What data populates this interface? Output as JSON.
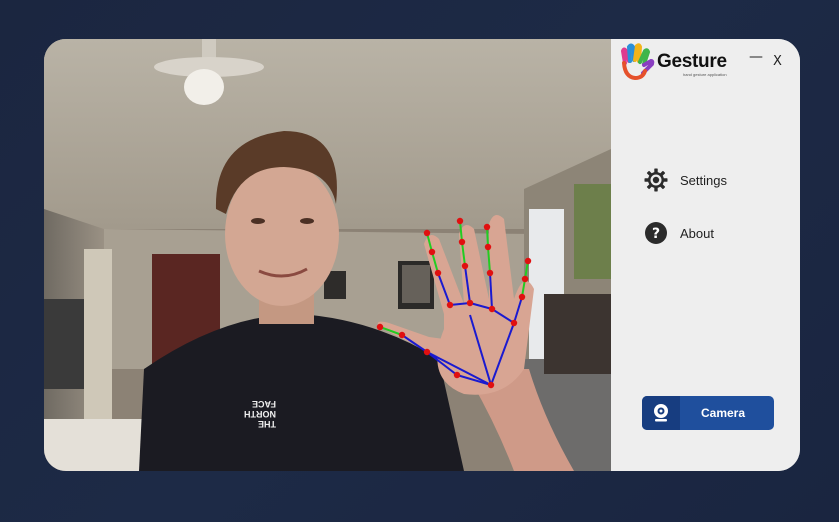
{
  "app": {
    "name": "Gesture",
    "tagline": "hand gesture application"
  },
  "window_controls": {
    "minimize": "—",
    "close": "X"
  },
  "menu": {
    "settings_label": "Settings",
    "about_label": "About"
  },
  "camera_button": {
    "label": "Camera"
  },
  "video": {
    "shirt_text_line1": "THE",
    "shirt_text_line2": "NORTH",
    "shirt_text_line3": "FACE"
  },
  "colors": {
    "background": "#1b2640",
    "sidebar": "#eeeeee",
    "camera_button": "#1f4f9d",
    "landmark_point": "#e01010",
    "palm_connection": "#1a1ad0",
    "finger_connection": "#22cc22"
  },
  "icons": {
    "logo": "hand-logo-icon",
    "settings": "gear-icon",
    "about": "question-icon",
    "camera": "webcam-icon"
  }
}
